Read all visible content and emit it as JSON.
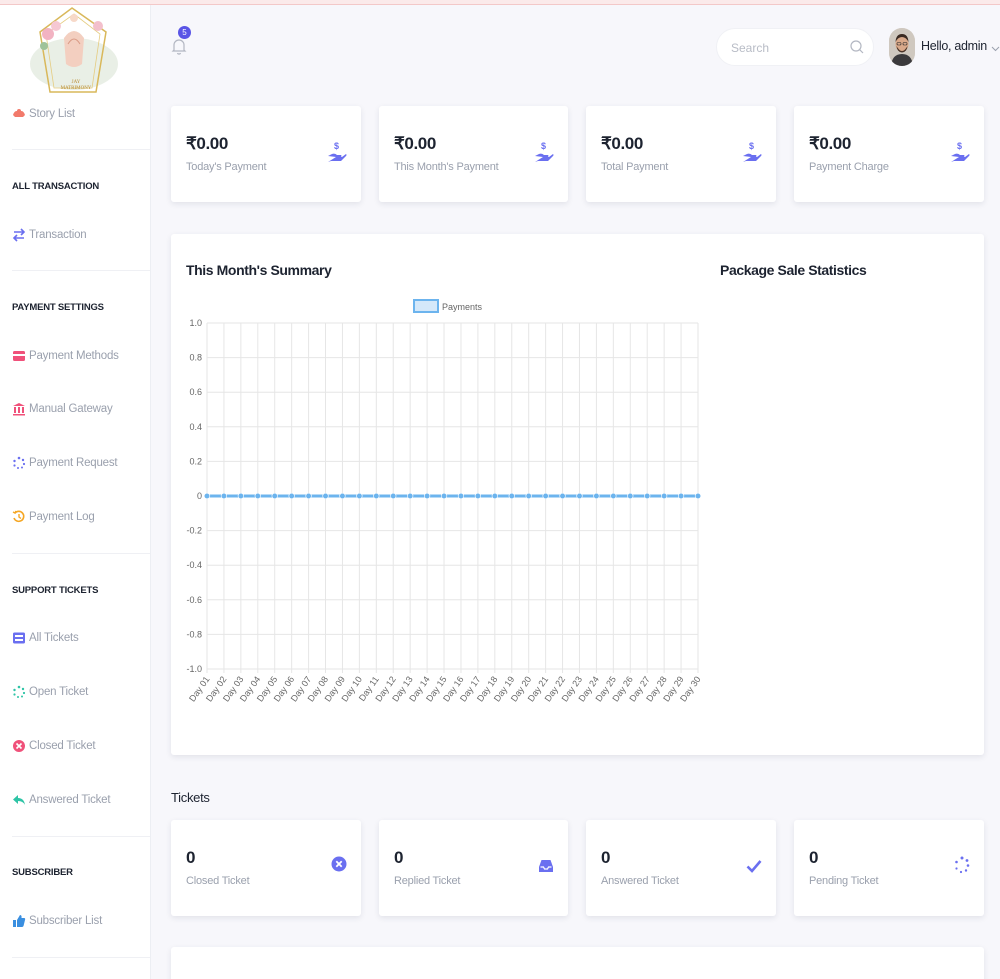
{
  "sidebar": {
    "logo_text": "JAY MATRIMONY",
    "story_list": "Story List",
    "sections": {
      "all_transaction": "ALL TRANSACTION",
      "payment_settings": "PAYMENT SETTINGS",
      "support_tickets": "SUPPORT TICKETS",
      "subscriber": "SUBSCRIBER"
    },
    "items": {
      "transaction": "Transaction",
      "payment_methods": "Payment Methods",
      "manual_gateway": "Manual Gateway",
      "payment_request": "Payment Request",
      "payment_log": "Payment Log",
      "all_tickets": "All Tickets",
      "open_ticket": "Open Ticket",
      "closed_ticket": "Closed Ticket",
      "answered_ticket": "Answered Ticket",
      "subscriber_list": "Subscriber List"
    }
  },
  "header": {
    "notification_count": "5",
    "search_placeholder": "Search",
    "greeting": "Hello, admin"
  },
  "payments": [
    {
      "value": "₹0.00",
      "label": "Today's Payment"
    },
    {
      "value": "₹0.00",
      "label": "This Month's Payment"
    },
    {
      "value": "₹0.00",
      "label": "Total Payment"
    },
    {
      "value": "₹0.00",
      "label": "Payment Charge"
    }
  ],
  "summary": {
    "title": "This Month's Summary",
    "package_title": "Package Sale Statistics"
  },
  "tickets": {
    "section_title": "Tickets",
    "cards": [
      {
        "value": "0",
        "label": "Closed Ticket"
      },
      {
        "value": "0",
        "label": "Replied Ticket"
      },
      {
        "value": "0",
        "label": "Answered Ticket"
      },
      {
        "value": "0",
        "label": "Pending Ticket"
      }
    ]
  },
  "colors": {
    "accent": "#5a55e6",
    "line": "#6cb4ee",
    "icon_blue": "#6a6ff0",
    "icon_red": "#f0517a",
    "icon_orange": "#f5a623",
    "icon_green": "#2ec4a6"
  },
  "chart_data": {
    "type": "line",
    "title": "",
    "xlabel": "",
    "ylabel": "",
    "legend": "top",
    "grid": true,
    "ylim": [
      -1.0,
      1.0
    ],
    "yticks": [
      "1.0",
      "0.8",
      "0.6",
      "0.4",
      "0.2",
      "0",
      "-0.2",
      "-0.4",
      "-0.6",
      "-0.8",
      "-1.0"
    ],
    "categories": [
      "Day 01",
      "Day 02",
      "Day 03",
      "Day 04",
      "Day 05",
      "Day 06",
      "Day 07",
      "Day 08",
      "Day 09",
      "Day 10",
      "Day 11",
      "Day 12",
      "Day 13",
      "Day 14",
      "Day 15",
      "Day 16",
      "Day 17",
      "Day 18",
      "Day 19",
      "Day 20",
      "Day 21",
      "Day 22",
      "Day 23",
      "Day 24",
      "Day 25",
      "Day 26",
      "Day 27",
      "Day 28",
      "Day 29",
      "Day 30"
    ],
    "series": [
      {
        "name": "Payments",
        "values": [
          0,
          0,
          0,
          0,
          0,
          0,
          0,
          0,
          0,
          0,
          0,
          0,
          0,
          0,
          0,
          0,
          0,
          0,
          0,
          0,
          0,
          0,
          0,
          0,
          0,
          0,
          0,
          0,
          0,
          0
        ]
      }
    ]
  }
}
